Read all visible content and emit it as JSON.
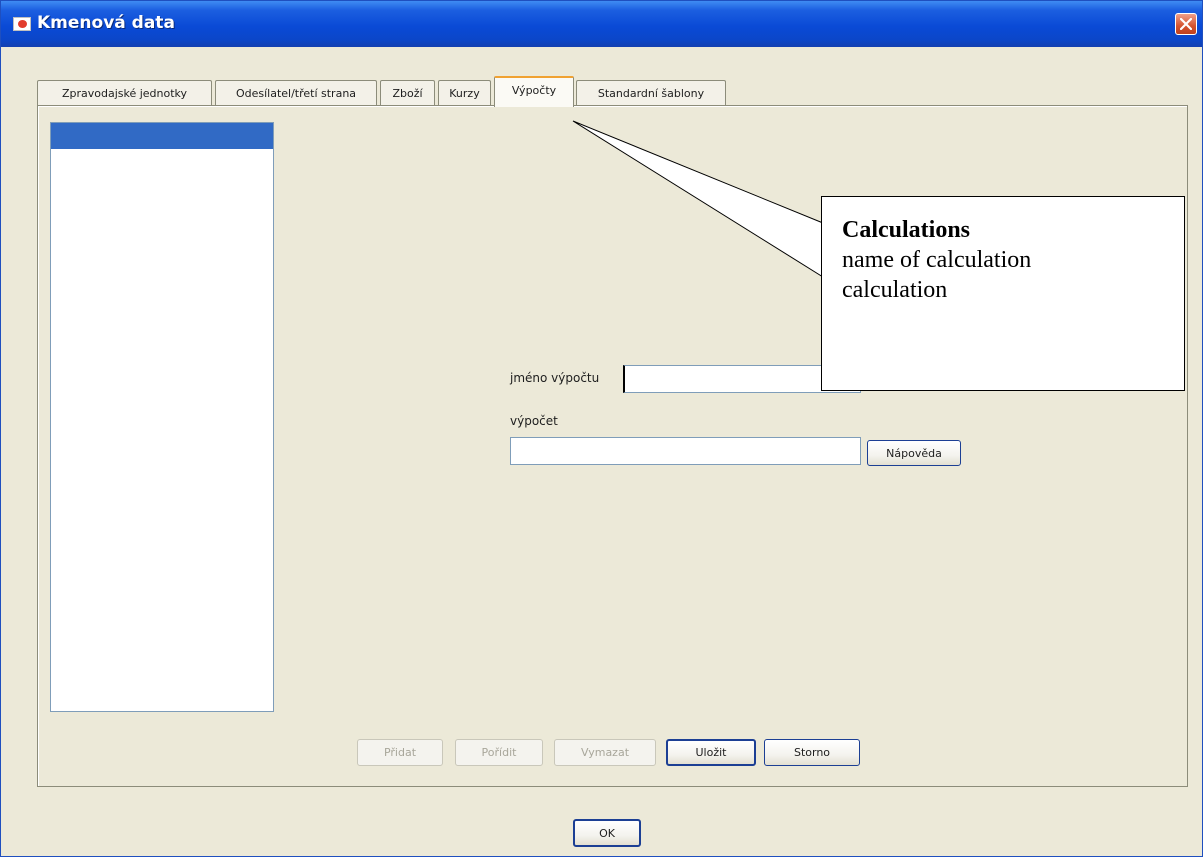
{
  "window": {
    "title": "Kmenová data",
    "accent_color": "#0a4ad6"
  },
  "tabs": [
    {
      "label": "Zpravodajské jednotky",
      "active": false
    },
    {
      "label": "Odesílatel/třetí strana",
      "active": false
    },
    {
      "label": "Zboží",
      "active": false
    },
    {
      "label": "Kurzy",
      "active": false
    },
    {
      "label": "Výpočty",
      "active": true
    },
    {
      "label": "Standardní šablony",
      "active": false
    }
  ],
  "form": {
    "name_label": "jméno výpočtu",
    "name_value": "",
    "calc_label": "výpočet",
    "calc_value": "",
    "help_button": "Nápověda"
  },
  "actions": {
    "add": {
      "label": "Přidat",
      "enabled": false
    },
    "acquire": {
      "label": "Pořídit",
      "enabled": false
    },
    "delete": {
      "label": "Vymazat",
      "enabled": false
    },
    "save": {
      "label": "Uložit",
      "enabled": true
    },
    "cancel": {
      "label": "Storno",
      "enabled": true
    }
  },
  "ok_button": "OK",
  "callout": {
    "title": "Calculations",
    "lines": [
      "name of calculation",
      "calculation"
    ]
  },
  "icons": {
    "app": "app-icon",
    "close": "close-icon"
  }
}
